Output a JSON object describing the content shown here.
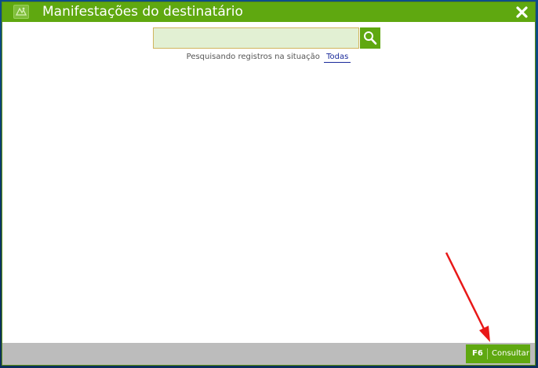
{
  "window": {
    "title": "Manifestações do destinatário",
    "close_icon": "close-icon",
    "app_icon": "app-logo-icon"
  },
  "search": {
    "value": "",
    "placeholder": "",
    "button_icon": "search-icon"
  },
  "status": {
    "prefix": "Pesquisando registros na situação",
    "filter_value": "Todas"
  },
  "footer": {
    "consult_key": "F6",
    "consult_label": "Consultar"
  },
  "annotation": {
    "arrow_color": "#e81818"
  },
  "colors": {
    "title_green": "#5fa810",
    "input_bg": "#e2f0d3",
    "input_border": "#d1b45c",
    "footer_gray": "#bcbcbc",
    "link_blue": "#1a2a9a"
  }
}
